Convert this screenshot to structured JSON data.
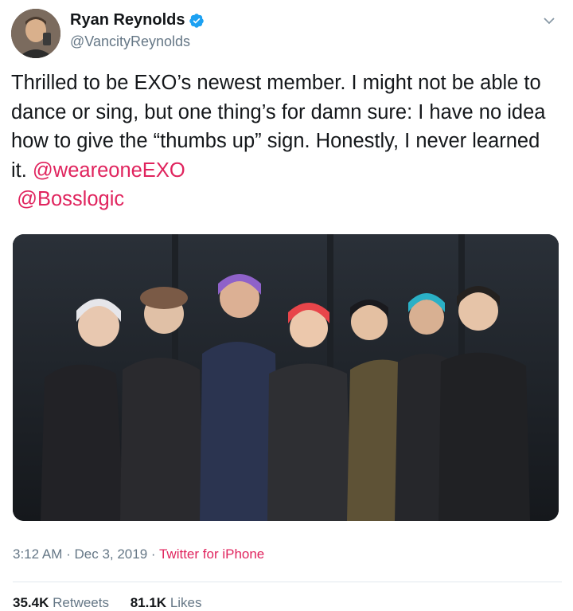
{
  "user": {
    "name": "Ryan Reynolds",
    "handle": "@VancityReynolds"
  },
  "tweet": {
    "text": "Thrilled to be EXO’s newest member. I might not be able to dance or sing, but one thing’s for damn sure: I have no idea how to give the “thumbs up” sign. Honestly, I never learned it. ",
    "mention_1": "@weareoneEXO",
    "mention_2": "@Bosslogic"
  },
  "meta": {
    "time": "3:12 AM",
    "separator_1": " · ",
    "date": "Dec 3, 2019",
    "separator_2": " · ",
    "source": "Twitter for iPhone"
  },
  "stats": {
    "retweets_count": "35.4K",
    "retweets_label": "Retweets",
    "likes_count": "81.1K",
    "likes_label": "Likes"
  },
  "colors": {
    "link": "#e0245e",
    "verified": "#1da1f2",
    "secondary_text": "#657786"
  },
  "icons": {
    "verified": "verified-badge-icon",
    "menu": "chevron-down-icon"
  }
}
